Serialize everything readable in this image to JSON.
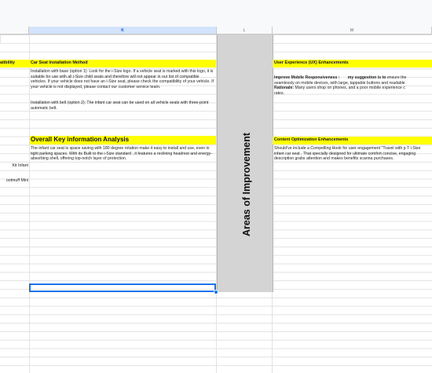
{
  "columns": {
    "k": "K",
    "l": "L",
    "m": "M"
  },
  "col_j": {
    "r1": "atibility",
    "r2": "Kit Infant",
    "r3": "ootmuff Mini"
  },
  "col_k": {
    "install_header": "Car Seat Installation Method",
    "install_p1": "Installation with base (option 1): Look for the i-Size logo. If a vehicle seat is marked with this logo, it is suitable for use with all i-Size child seats and therefore will not appear in our list of compatible vehicles. If your vehicle does not have an i-Size seat, please check the compatibility of your vehicle. If your vehicle is not displayed, please contact our customer service team.",
    "install_p2": "Installation with belt (option 2): The infant car seat can be used on all vehicle seats with three-point automatic belt.",
    "overall_header": "Overall Key information Analysis",
    "overall_text": "The infant car seat is space saving with 180 degree rotation make it easy to install and use, even in tight parking spaces. With its Built to the i-Size standard , it features a reclining headrest and energy-absorbing shell, offering top-notch layer of protection."
  },
  "col_l": {
    "vertical_label": "Areas of Improvement"
  },
  "col_m": {
    "ux_header": "User Experience (UX) Enhancements",
    "ux_title": "Improve Mobile Responsiveness :",
    "ux_suggestion_label": "my suggestion is to",
    "ux_text1": "ensure the",
    "ux_text2": "seamlessly on mobile devices, with large, tappable buttons and readable",
    "ux_rationale_label": "Rationale:",
    "ux_rationale": "Many users shop on phones, and a poor mobile experience c",
    "ux_rates": "rates.",
    "content_header": "Content Optimization Enhancements",
    "content_text": "Should've include a Compelling Hook for user engagement \"Travel with p T i-Size infant car seat . That specially designed for ultimate comfort concise, engaging description grabs attention and makes benefits scanna purchases."
  },
  "colors": {
    "highlight": "#ffff00",
    "merged_fill": "#d4d4d4",
    "selection": "#1a73e8"
  }
}
